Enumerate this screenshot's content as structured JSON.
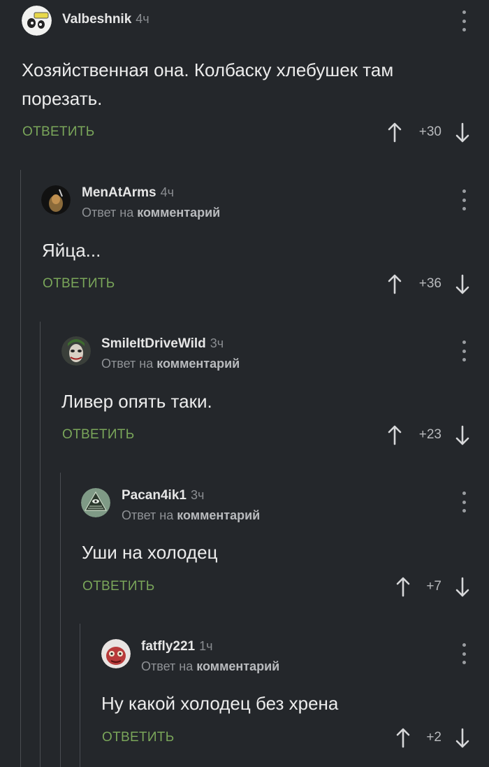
{
  "comments": [
    {
      "author": "Valbeshnik",
      "time": "4ч",
      "reply_prefix": "",
      "reply_link": "",
      "text": "Хозяйственная она. Колбаску хлебушек там порезать.",
      "reply_label": "ОТВЕТИТЬ",
      "score": "+30"
    },
    {
      "author": "MenAtArms",
      "time": "4ч",
      "reply_prefix": "Ответ на",
      "reply_link": "комментарий",
      "text": "Яйца...",
      "reply_label": "ОТВЕТИТЬ",
      "score": "+36"
    },
    {
      "author": "SmileItDriveWild",
      "time": "3ч",
      "reply_prefix": "Ответ на",
      "reply_link": "комментарий",
      "text": "Ливер опять таки.",
      "reply_label": "ОТВЕТИТЬ",
      "score": "+23"
    },
    {
      "author": "Pacan4ik1",
      "time": "3ч",
      "reply_prefix": "Ответ на",
      "reply_link": "комментарий",
      "text": "Уши на холодец",
      "reply_label": "ОТВЕТИТЬ",
      "score": "+7"
    },
    {
      "author": "fatfly221",
      "time": "1ч",
      "reply_prefix": "Ответ на",
      "reply_link": "комментарий",
      "text": "Ну какой холодец без хрена",
      "reply_label": "ОТВЕТИТЬ",
      "score": "+2"
    }
  ],
  "colors": {
    "background": "#24272b",
    "reply_button": "#7aa65a",
    "thread_line": "#4a4d52"
  },
  "icons": {
    "menu": "more-vertical-icon",
    "up": "arrow-up-icon",
    "down": "arrow-down-icon"
  }
}
